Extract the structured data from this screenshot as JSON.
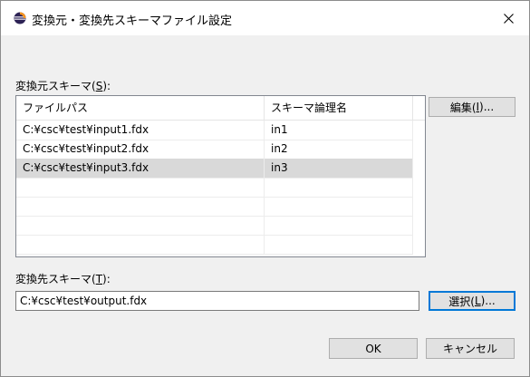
{
  "window": {
    "title": "変換元・変換先スキーマファイル設定",
    "icon": "eclipse-icon",
    "close_glyph": "✕"
  },
  "source": {
    "label_prefix": "変換元スキーマ(",
    "label_mnemonic": "S",
    "label_suffix": "):",
    "columns": [
      "ファイルパス",
      "スキーマ論理名"
    ],
    "rows": [
      {
        "path": "C:¥csc¥test¥input1.fdx",
        "name": "in1",
        "selected": false
      },
      {
        "path": "C:¥csc¥test¥input2.fdx",
        "name": "in2",
        "selected": false
      },
      {
        "path": "C:¥csc¥test¥input3.fdx",
        "name": "in3",
        "selected": true
      }
    ],
    "empty_rows": 4,
    "edit_button": {
      "prefix": "編集(",
      "mnemonic": "I",
      "suffix": ")..."
    }
  },
  "destination": {
    "label_prefix": "変換先スキーマ(",
    "label_mnemonic": "T",
    "label_suffix": "):",
    "value": "C:¥csc¥test¥output.fdx",
    "select_button": {
      "prefix": "選択(",
      "mnemonic": "L",
      "suffix": ")..."
    }
  },
  "footer": {
    "ok_label": "OK",
    "cancel_label": "キャンセル"
  },
  "colors": {
    "window_bg": "#f0f0f0",
    "selected_row": "#d9d9d9",
    "focus_border": "#0078d7"
  }
}
